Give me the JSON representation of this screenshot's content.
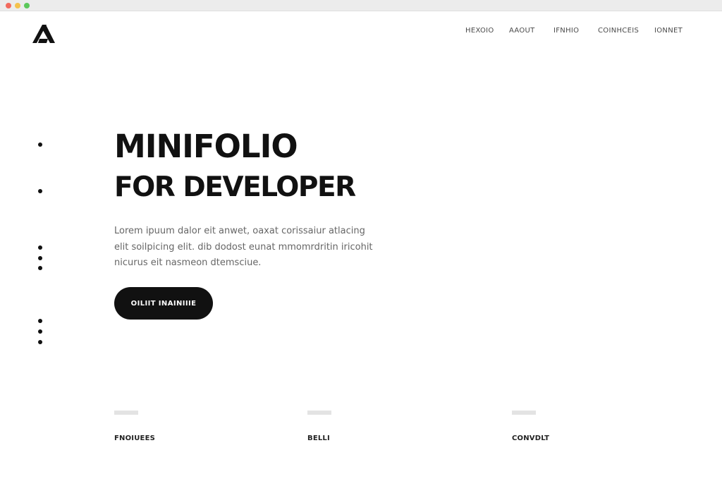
{
  "window": {
    "controls": [
      "close",
      "minimize",
      "maximize"
    ]
  },
  "brand": {
    "logo_icon": "triangle-a-logo"
  },
  "nav": {
    "items": [
      "HEXOIO",
      "AAOUT",
      "IFNHIO",
      "COINHCEIS",
      "IONNET"
    ]
  },
  "hero": {
    "title_line1": "MINIFOLIO",
    "title_line2": "FOR DEVELOPER",
    "description": "Lorem ipuum dalor eit anwet, oaxat corissaiur atlacing elit soilpicing elit. dib dodost eunat mmomrdritin iricohit nicurus eit nasmeon dtemsciue.",
    "cta_label": "OILIIT INAINIIIE"
  },
  "features": [
    {
      "label": "FNOIUEES"
    },
    {
      "label": "BELLI"
    },
    {
      "label": "CONVDLT"
    }
  ],
  "colors": {
    "background": "#ffffff",
    "text_primary": "#111111",
    "text_muted": "#666666",
    "button_bg": "#111111",
    "accent_bar": "#e3e3e3"
  }
}
